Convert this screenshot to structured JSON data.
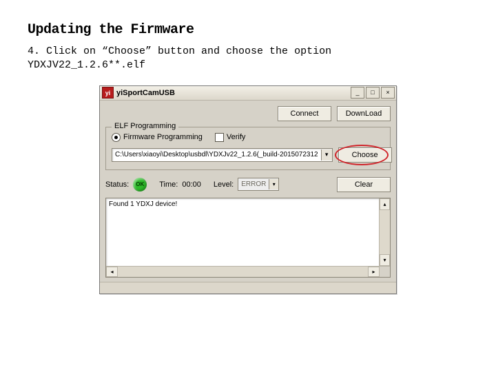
{
  "doc": {
    "heading": "Updating the Firmware",
    "step_text": "4. Click on “Choose” button and choose the option YDXJV22_1.2.6**.elf"
  },
  "window": {
    "title": "yiSportCamUSB",
    "buttons": {
      "connect": "Connect",
      "download": "DownLoad",
      "choose": "Choose",
      "clear": "Clear"
    },
    "fieldset_legend": "ELF Programming",
    "radio_firmware_label": "Firmware Programming",
    "checkbox_verify_label": "Verify",
    "path_value": "C:\\Users\\xiaoyi\\Desktop\\usbdl\\YDXJv22_1.2.6(_build-2015072312",
    "status_label": "Status:",
    "status_value": "OK",
    "time_label": "Time:",
    "time_value": "00:00",
    "level_label": "Level:",
    "level_value": "ERROR",
    "log_text": "Found 1 YDXJ device!"
  }
}
